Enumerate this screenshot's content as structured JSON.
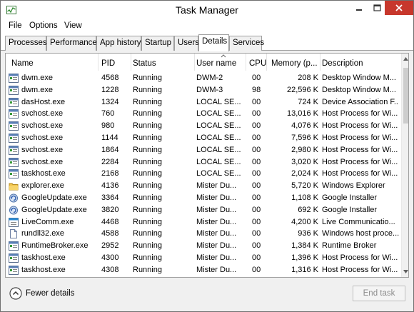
{
  "window": {
    "title": "Task Manager",
    "menu": [
      "File",
      "Options",
      "View"
    ]
  },
  "tabs": [
    "Processes",
    "Performance",
    "App history",
    "Startup",
    "Users",
    "Details",
    "Services"
  ],
  "active_tab": "Details",
  "columns": {
    "name": "Name",
    "pid": "PID",
    "status": "Status",
    "user": "User name",
    "cpu": "CPU",
    "memory": "Memory (p...",
    "description": "Description"
  },
  "rows": [
    {
      "icon": "window-app-icon",
      "name": "dwm.exe",
      "pid": "4568",
      "status": "Running",
      "user": "DWM-2",
      "cpu": "00",
      "memory": "208 K",
      "description": "Desktop Window M..."
    },
    {
      "icon": "window-app-icon",
      "name": "dwm.exe",
      "pid": "1228",
      "status": "Running",
      "user": "DWM-3",
      "cpu": "98",
      "memory": "22,596 K",
      "description": "Desktop Window M..."
    },
    {
      "icon": "window-app-icon",
      "name": "dasHost.exe",
      "pid": "1324",
      "status": "Running",
      "user": "LOCAL SE...",
      "cpu": "00",
      "memory": "724 K",
      "description": "Device Association F..."
    },
    {
      "icon": "window-app-icon",
      "name": "svchost.exe",
      "pid": "760",
      "status": "Running",
      "user": "LOCAL SE...",
      "cpu": "00",
      "memory": "13,016 K",
      "description": "Host Process for Wi..."
    },
    {
      "icon": "window-app-icon",
      "name": "svchost.exe",
      "pid": "980",
      "status": "Running",
      "user": "LOCAL SE...",
      "cpu": "00",
      "memory": "4,076 K",
      "description": "Host Process for Wi..."
    },
    {
      "icon": "window-app-icon",
      "name": "svchost.exe",
      "pid": "1144",
      "status": "Running",
      "user": "LOCAL SE...",
      "cpu": "00",
      "memory": "7,596 K",
      "description": "Host Process for Wi..."
    },
    {
      "icon": "window-app-icon",
      "name": "svchost.exe",
      "pid": "1864",
      "status": "Running",
      "user": "LOCAL SE...",
      "cpu": "00",
      "memory": "2,980 K",
      "description": "Host Process for Wi..."
    },
    {
      "icon": "window-app-icon",
      "name": "svchost.exe",
      "pid": "2284",
      "status": "Running",
      "user": "LOCAL SE...",
      "cpu": "00",
      "memory": "3,020 K",
      "description": "Host Process for Wi..."
    },
    {
      "icon": "window-app-icon",
      "name": "taskhost.exe",
      "pid": "2168",
      "status": "Running",
      "user": "LOCAL SE...",
      "cpu": "00",
      "memory": "2,024 K",
      "description": "Host Process for Wi..."
    },
    {
      "icon": "folder-icon",
      "name": "explorer.exe",
      "pid": "4136",
      "status": "Running",
      "user": "Mister Du...",
      "cpu": "00",
      "memory": "5,720 K",
      "description": "Windows Explorer"
    },
    {
      "icon": "update-icon",
      "name": "GoogleUpdate.exe",
      "pid": "3364",
      "status": "Running",
      "user": "Mister Du...",
      "cpu": "00",
      "memory": "1,108 K",
      "description": "Google Installer"
    },
    {
      "icon": "update-icon",
      "name": "GoogleUpdate.exe",
      "pid": "3820",
      "status": "Running",
      "user": "Mister Du...",
      "cpu": "00",
      "memory": "692 K",
      "description": "Google Installer"
    },
    {
      "icon": "livecomm-icon",
      "name": "LiveComm.exe",
      "pid": "4468",
      "status": "Running",
      "user": "Mister Du...",
      "cpu": "00",
      "memory": "4,200 K",
      "description": "Live Communicatio..."
    },
    {
      "icon": "document-icon",
      "name": "rundll32.exe",
      "pid": "4588",
      "status": "Running",
      "user": "Mister Du...",
      "cpu": "00",
      "memory": "936 K",
      "description": "Windows host proce..."
    },
    {
      "icon": "window-app-icon",
      "name": "RuntimeBroker.exe",
      "pid": "2952",
      "status": "Running",
      "user": "Mister Du...",
      "cpu": "00",
      "memory": "1,384 K",
      "description": "Runtime Broker"
    },
    {
      "icon": "window-app-icon",
      "name": "taskhost.exe",
      "pid": "4300",
      "status": "Running",
      "user": "Mister Du...",
      "cpu": "00",
      "memory": "1,396 K",
      "description": "Host Process for Wi..."
    },
    {
      "icon": "window-app-icon",
      "name": "taskhost.exe",
      "pid": "4308",
      "status": "Running",
      "user": "Mister Du...",
      "cpu": "00",
      "memory": "1,316 K",
      "description": "Host Process for Wi..."
    }
  ],
  "footer": {
    "fewer_details": "Fewer details",
    "end_task": "End task"
  },
  "colors": {
    "close_button": "#c7372c",
    "border": "#a0a0a0"
  }
}
